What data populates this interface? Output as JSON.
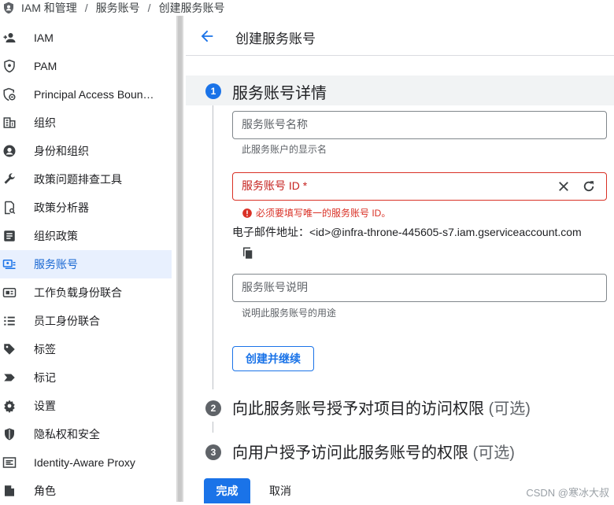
{
  "breadcrumb": {
    "items": [
      "IAM 和管理",
      "服务账号",
      "创建服务账号"
    ],
    "separator": "/"
  },
  "sidebar": {
    "items": [
      {
        "label": "IAM",
        "icon": "person-add-icon"
      },
      {
        "label": "PAM",
        "icon": "shield-icon"
      },
      {
        "label": "Principal Access Boun…",
        "icon": "policy-shield-icon"
      },
      {
        "label": "组织",
        "icon": "organization-icon"
      },
      {
        "label": "身份和组织",
        "icon": "account-circle-icon"
      },
      {
        "label": "政策问题排查工具",
        "icon": "wrench-icon"
      },
      {
        "label": "政策分析器",
        "icon": "document-search-icon"
      },
      {
        "label": "组织政策",
        "icon": "article-icon"
      },
      {
        "label": "服务账号",
        "icon": "service-account-icon",
        "active": true
      },
      {
        "label": "工作负载身份联合",
        "icon": "id-card-icon"
      },
      {
        "label": "员工身份联合",
        "icon": "list-icon"
      },
      {
        "label": "标签",
        "icon": "tag-icon"
      },
      {
        "label": "标记",
        "icon": "label-icon"
      },
      {
        "label": "设置",
        "icon": "gear-icon"
      },
      {
        "label": "隐私权和安全",
        "icon": "privacy-shield-icon"
      },
      {
        "label": "Identity-Aware Proxy",
        "icon": "proxy-icon"
      },
      {
        "label": "角色",
        "icon": "roles-icon"
      }
    ]
  },
  "header": {
    "title": "创建服务账号"
  },
  "steps": {
    "step1": {
      "number": "1",
      "title": "服务账号详情"
    },
    "step2": {
      "number": "2",
      "title": "向此服务账号授予对项目的访问权限",
      "optional": "(可选)"
    },
    "step3": {
      "number": "3",
      "title": "向用户授予访问此服务账号的权限",
      "optional": "(可选)"
    }
  },
  "form": {
    "name": {
      "placeholder": "服务账号名称",
      "hint": "此服务账户的显示名",
      "value": ""
    },
    "id": {
      "placeholder": "服务账号 ID *",
      "error": "必须要填写唯一的服务账号 ID。",
      "value": ""
    },
    "email": "电子邮件地址：<id>@infra-throne-445605-s7.iam.gserviceaccount.com",
    "description": {
      "placeholder": "服务账号说明",
      "hint": "说明此服务账号的用途",
      "value": ""
    },
    "create_button": "创建并继续"
  },
  "footer": {
    "done": "完成",
    "cancel": "取消"
  },
  "watermark": "CSDN @寒冰大叔",
  "colors": {
    "accent": "#1a73e8",
    "error": "#d93025",
    "active_bg": "#e8f0fe",
    "step_grey": "#5f6368"
  }
}
